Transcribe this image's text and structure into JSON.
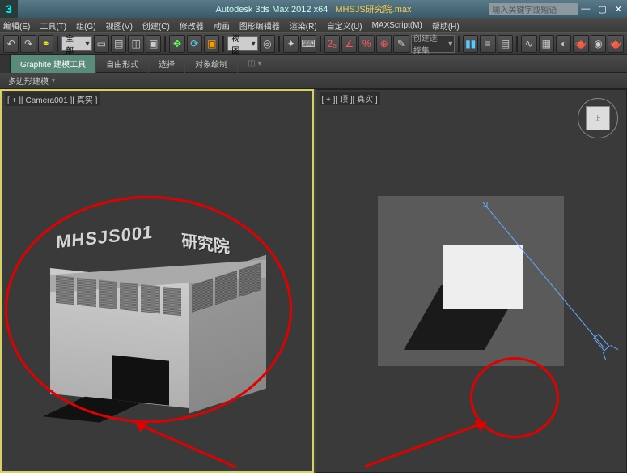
{
  "titlebar": {
    "app_title": "Autodesk 3ds Max 2012 x64",
    "filename": "MHSJS研究院.max",
    "search_placeholder": "输入关键字或短语"
  },
  "menus": {
    "items": [
      "编辑(E)",
      "工具(T)",
      "组(G)",
      "视图(V)",
      "创建(C)",
      "修改器",
      "动画",
      "图形编辑器",
      "渲染(R)",
      "自定义(U)",
      "MAXScript(M)",
      "帮助(H)"
    ]
  },
  "toolbar": {
    "selection_set": "全部",
    "view_mode": "视图",
    "named_set": "创建选择集"
  },
  "ribbon": {
    "tabs": [
      "Graphite 建模工具",
      "自由形式",
      "选择",
      "对象绘制"
    ],
    "active": 0,
    "sub": "多边形建模"
  },
  "viewports": {
    "left_label": "[ + ][ Camera001 ][ 真实 ]",
    "right_label": "[ + ][ 顶 ][ 真实 ]",
    "sign_text_1": "MHSJS001",
    "sign_text_2": "研究院",
    "viewcube_face": "上"
  }
}
